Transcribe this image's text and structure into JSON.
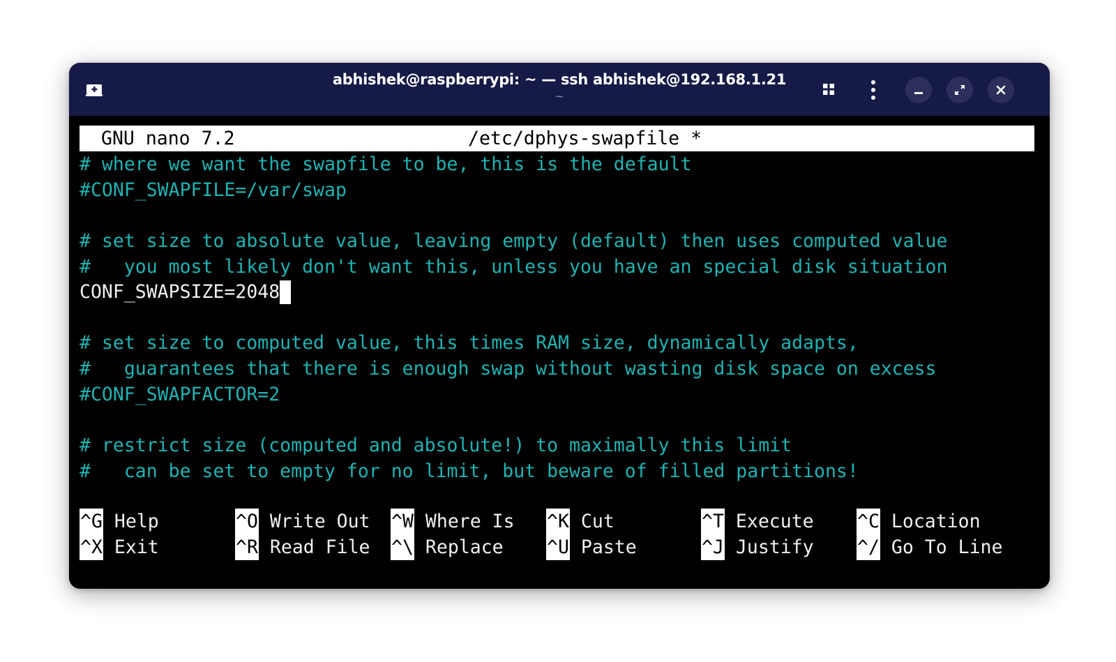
{
  "window": {
    "title": "abhishek@raspberrypi: ~ — ssh abhishek@192.168.1.21",
    "subtitle": "~"
  },
  "nano": {
    "app_version": "GNU nano 7.2",
    "filename": "/etc/dphys-swapfile *"
  },
  "file_lines": [
    "# where we want the swapfile to be, this is the default",
    "#CONF_SWAPFILE=/var/swap",
    "",
    "# set size to absolute value, leaving empty (default) then uses computed value",
    "#   you most likely don't want this, unless you have an special disk situation",
    "CONF_SWAPSIZE=2048",
    "",
    "# set size to computed value, this times RAM size, dynamically adapts,",
    "#   guarantees that there is enough swap without wasting disk space on excess",
    "#CONF_SWAPFACTOR=2",
    "",
    "# restrict size (computed and absolute!) to maximally this limit",
    "#   can be set to empty for no limit, but beware of filled partitions!"
  ],
  "shortcuts_row1": [
    {
      "key": "^G",
      "label": "Help"
    },
    {
      "key": "^O",
      "label": "Write Out"
    },
    {
      "key": "^W",
      "label": "Where Is"
    },
    {
      "key": "^K",
      "label": "Cut"
    },
    {
      "key": "^T",
      "label": "Execute"
    },
    {
      "key": "^C",
      "label": "Location"
    }
  ],
  "shortcuts_row2": [
    {
      "key": "^X",
      "label": "Exit"
    },
    {
      "key": "^R",
      "label": "Read File"
    },
    {
      "key": "^\\",
      "label": "Replace"
    },
    {
      "key": "^U",
      "label": "Paste"
    },
    {
      "key": "^J",
      "label": "Justify"
    },
    {
      "key": "^/",
      "label": "Go To Line"
    }
  ],
  "colors": {
    "titlebar": "#161a46",
    "comment": "#1fb3b3",
    "text": "#f0f0f0",
    "background": "#000000"
  },
  "icons": {
    "new_tab": "new-tab-icon",
    "view_grid": "grid-icon",
    "menu": "kebab-menu-icon",
    "minimize": "minimize-icon",
    "maximize": "maximize-icon",
    "close": "close-icon"
  }
}
